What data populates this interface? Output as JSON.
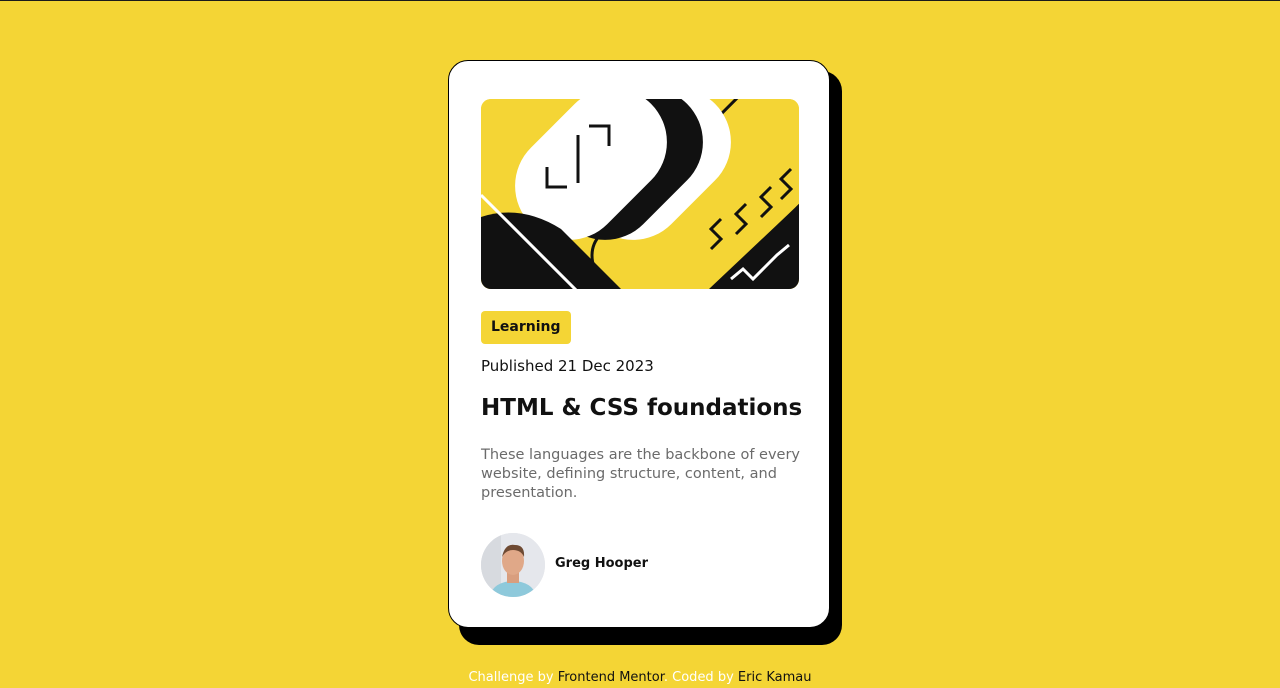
{
  "card": {
    "tag": "Learning",
    "published": "Published 21 Dec 2023",
    "title": "HTML & CSS foundations",
    "description": "These languages are the backbone of every website, defining structure, content, and presentation.",
    "author": "Greg Hooper"
  },
  "footer": {
    "challenge_prefix": "Challenge by",
    "challenge_link": "Frontend Mentor",
    "separator": ".",
    "coded_prefix": "Coded by",
    "coded_link": "Eric Kamau"
  },
  "colors": {
    "background": "#f4d535",
    "card": "#ffffff",
    "shadow": "#000000",
    "text": "#111111",
    "muted": "#6b6b6b"
  },
  "icons": {
    "hero": "hero-illustration",
    "avatar": "author-avatar"
  }
}
